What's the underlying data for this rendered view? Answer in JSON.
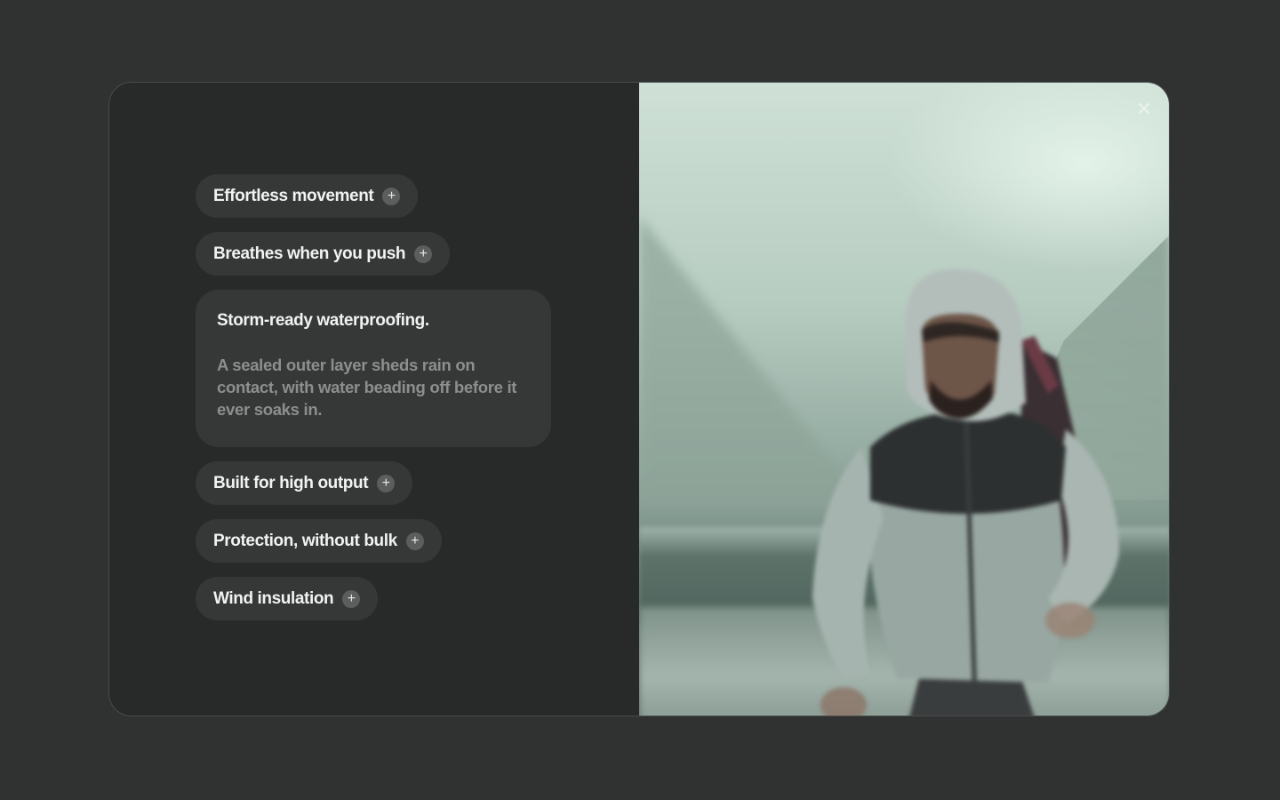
{
  "features": {
    "items": [
      {
        "label": "Effortless movement",
        "icon": "plus-icon"
      },
      {
        "label": "Breathes when you push",
        "icon": "plus-icon"
      },
      {
        "label": "Storm-ready waterproofing.",
        "description": "A sealed outer layer sheds rain on contact, with water beading off before it ever soaks in.",
        "expanded": true
      },
      {
        "label": "Built for high output",
        "icon": "plus-icon"
      },
      {
        "label": "Protection, without bulk",
        "icon": "plus-icon"
      },
      {
        "label": "Wind insulation",
        "icon": "plus-icon"
      }
    ]
  },
  "icons": {
    "plus": "+",
    "close": "✕"
  },
  "colors": {
    "page_background": "#303131",
    "modal_background": "#282929",
    "chip_background": "#363737",
    "chip_text": "#f1f2f2",
    "description_text": "#8d8e8e"
  }
}
